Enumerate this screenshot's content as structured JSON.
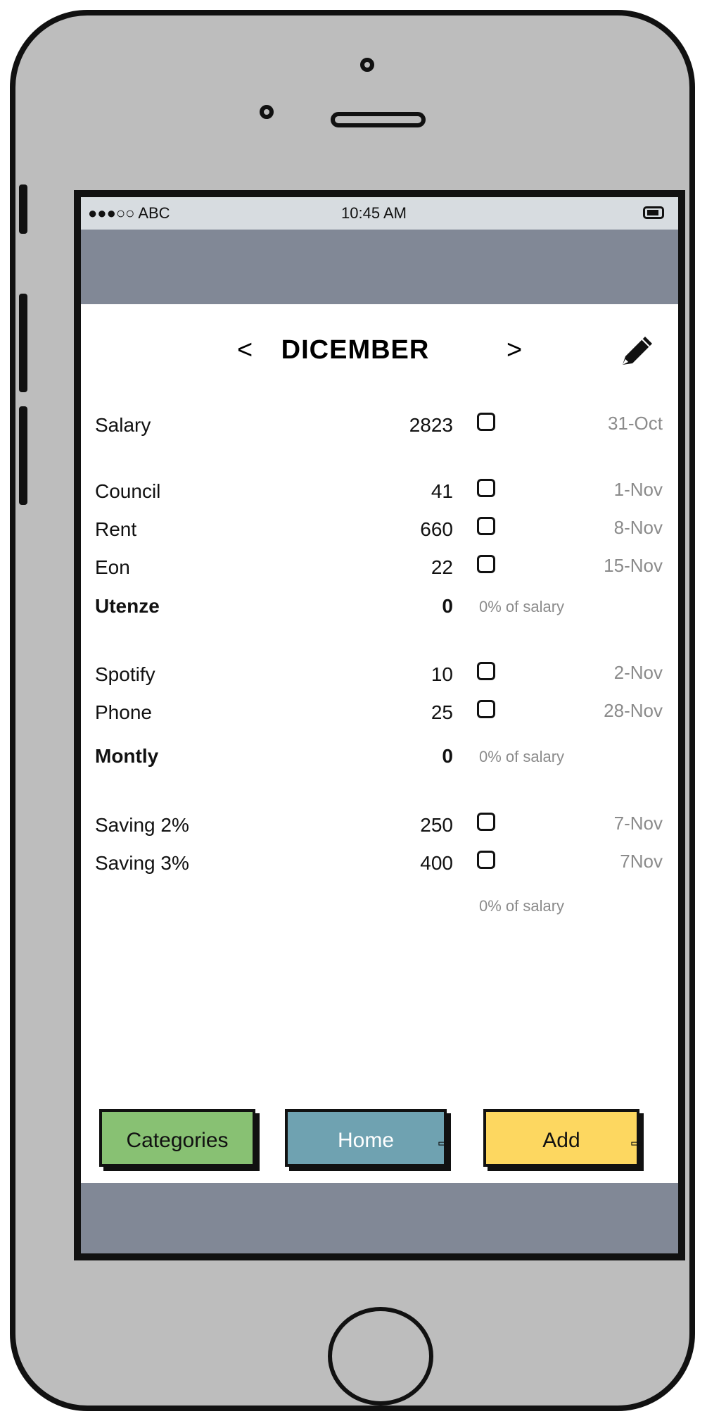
{
  "status": {
    "carrier": "●●●○○ ABC",
    "time": "10:45 AM"
  },
  "header": {
    "month": "DICEMBER",
    "prev": "<",
    "next": ">"
  },
  "rows": [
    {
      "label": "Salary",
      "amount": "2823",
      "date": "31-Oct"
    },
    {
      "label": "Council",
      "amount": "41",
      "date": "1-Nov"
    },
    {
      "label": "Rent",
      "amount": "660",
      "date": "8-Nov"
    },
    {
      "label": "Eon",
      "amount": "22",
      "date": "15-Nov"
    },
    {
      "label": "Spotify",
      "amount": "10",
      "date": "2-Nov"
    },
    {
      "label": "Phone",
      "amount": "25",
      "date": "28-Nov"
    },
    {
      "label": "Saving 2%",
      "amount": "250",
      "date": "7-Nov"
    },
    {
      "label": "Saving 3%",
      "amount": "400",
      "date": "7Nov"
    }
  ],
  "subtotals": [
    {
      "label": "Utenze",
      "amount": "0",
      "pct": "0% of salary"
    },
    {
      "label": "Montly",
      "amount": "0",
      "pct": "0% of salary"
    },
    {
      "label": "",
      "amount": "",
      "pct": "0% of salary"
    }
  ],
  "buttons": {
    "categories": "Categories",
    "home": "Home",
    "add": "Add"
  },
  "icons": {
    "edit": "pencil-icon",
    "link": "link-arrow-icon"
  }
}
